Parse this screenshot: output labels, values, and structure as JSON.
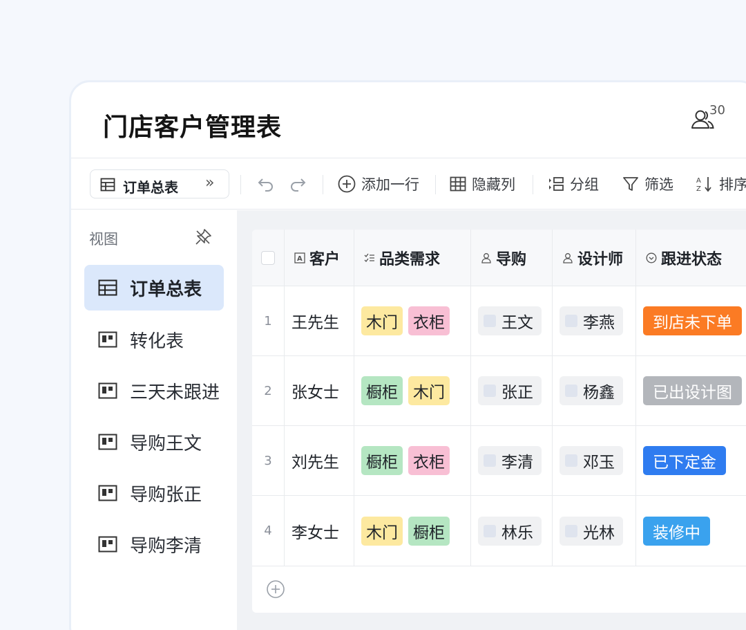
{
  "title": "门店客户管理表",
  "collaborators": {
    "count": "30",
    "icon": "users-icon"
  },
  "toolbar": {
    "view_label": "订单总表",
    "view_icon": "grid-table-icon",
    "expand_icon": "double-chevron-right-icon",
    "undo_icon": "undo-icon",
    "redo_icon": "redo-icon",
    "add_row": "添加一行",
    "hide_columns": "隐藏列",
    "group": "分组",
    "filter": "筛选",
    "sort": "排序"
  },
  "sidebar": {
    "heading": "视图",
    "items": [
      {
        "label": "订单总表",
        "icon": "grid-table-icon",
        "active": true
      },
      {
        "label": "转化表",
        "icon": "kanban-icon",
        "active": false
      },
      {
        "label": "三天未跟进",
        "icon": "kanban-icon",
        "active": false
      },
      {
        "label": "导购王文",
        "icon": "kanban-icon",
        "active": false
      },
      {
        "label": "导购张正",
        "icon": "kanban-icon",
        "active": false
      },
      {
        "label": "导购李清",
        "icon": "kanban-icon",
        "active": false
      }
    ]
  },
  "table": {
    "columns": {
      "customer": "客户",
      "category": "品类需求",
      "guide": "导购",
      "designer": "设计师",
      "status": "跟进状态"
    },
    "rows": [
      {
        "num": "1",
        "customer": "王先生",
        "tags": [
          {
            "text": "木门",
            "color": "#fde9a0"
          },
          {
            "text": "衣柜",
            "color": "#f8bfd4"
          }
        ],
        "guide": "王文",
        "designer": "李燕",
        "status": {
          "text": "到店未下单",
          "color": "#fb7b24"
        }
      },
      {
        "num": "2",
        "customer": "张女士",
        "tags": [
          {
            "text": "橱柜",
            "color": "#b5e6c2"
          },
          {
            "text": "木门",
            "color": "#fde9a0"
          }
        ],
        "guide": "张正",
        "designer": "杨鑫",
        "status": {
          "text": "已出设计图",
          "color": "#b3b6bb"
        }
      },
      {
        "num": "3",
        "customer": "刘先生",
        "tags": [
          {
            "text": "橱柜",
            "color": "#b5e6c2"
          },
          {
            "text": "衣柜",
            "color": "#f8bfd4"
          }
        ],
        "guide": "李清",
        "designer": "邓玉",
        "status": {
          "text": "已下定金",
          "color": "#2f7cf0"
        }
      },
      {
        "num": "4",
        "customer": "李女士",
        "tags": [
          {
            "text": "木门",
            "color": "#fde9a0"
          },
          {
            "text": "橱柜",
            "color": "#b5e6c2"
          }
        ],
        "guide": "林乐",
        "designer": "光林",
        "status": {
          "text": "装修中",
          "color": "#3aa2ee"
        }
      }
    ]
  }
}
